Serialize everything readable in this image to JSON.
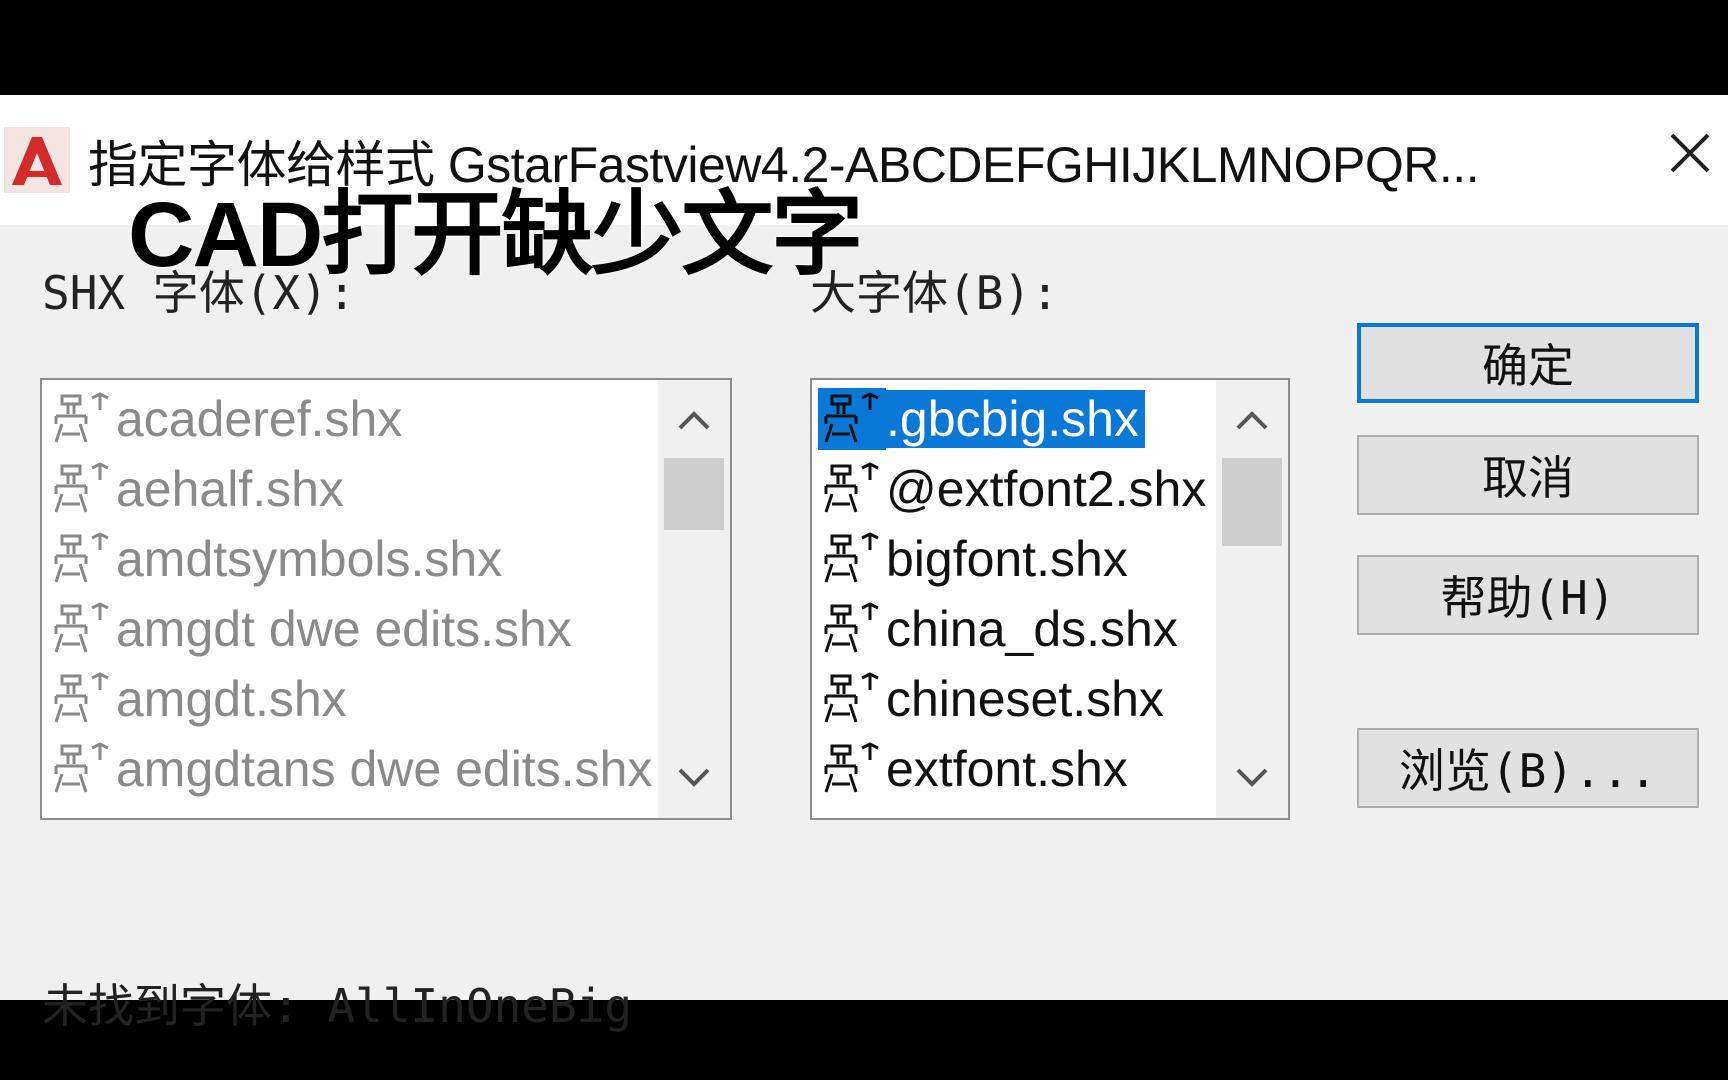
{
  "window": {
    "title": "指定字体给样式 GstarFastview4.2-ABCDEFGHIJKLMNOPQR...",
    "icon": "autocad-a-icon",
    "close_icon": "close-icon"
  },
  "overlay_caption": "CAD打开缺少文字",
  "shx_font": {
    "label": "SHX 字体(X):",
    "items": [
      {
        "name": "acaderef.shx"
      },
      {
        "name": "aehalf.shx"
      },
      {
        "name": "amdtsymbols.shx"
      },
      {
        "name": "amgdt dwe edits.shx"
      },
      {
        "name": "amgdt.shx"
      },
      {
        "name": "amgdtans dwe edits.shx"
      }
    ]
  },
  "big_font": {
    "label": "大字体(B):",
    "selected": ".gbcbig.shx",
    "items": [
      {
        "name": ".gbcbig.shx"
      },
      {
        "name": "@extfont2.shx"
      },
      {
        "name": "bigfont.shx"
      },
      {
        "name": "china_ds.shx"
      },
      {
        "name": "chineset.shx"
      },
      {
        "name": "extfont.shx"
      }
    ]
  },
  "buttons": {
    "ok": "确定",
    "cancel": "取消",
    "help": "帮助(H)",
    "browse": "浏览(B)..."
  },
  "status": {
    "label": "未找到字体:",
    "value": "AllInOneBig"
  },
  "colors": {
    "selection": "#0a78d7",
    "disabled_text": "#8a8a8a"
  }
}
